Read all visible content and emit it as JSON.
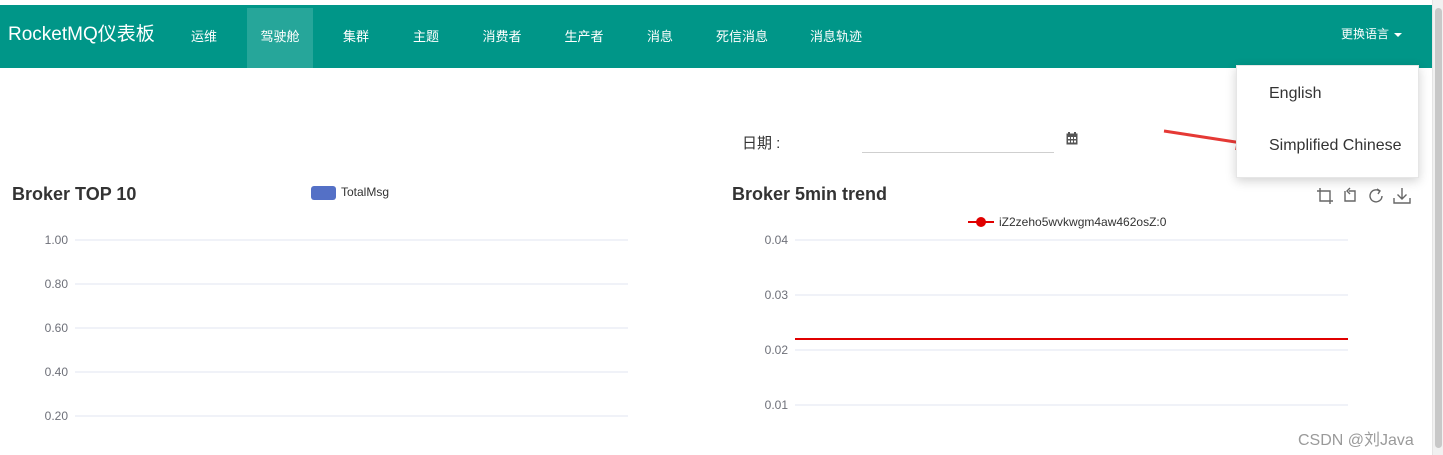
{
  "navbar": {
    "brand": "RocketMQ仪表板",
    "items": [
      {
        "label": "运维",
        "active": false
      },
      {
        "label": "驾驶舱",
        "active": true
      },
      {
        "label": "集群",
        "active": false
      },
      {
        "label": "主题",
        "active": false
      },
      {
        "label": "消费者",
        "active": false
      },
      {
        "label": "生产者",
        "active": false
      },
      {
        "label": "消息",
        "active": false
      },
      {
        "label": "死信消息",
        "active": false
      },
      {
        "label": "消息轨迹",
        "active": false
      }
    ],
    "language_label": "更换语言"
  },
  "language_dropdown": {
    "options": [
      "English",
      "Simplified Chinese"
    ]
  },
  "filter": {
    "date_label": "日期 :",
    "date_value": ""
  },
  "colors": {
    "navbar": "#009688",
    "active_tab": "#26a69a",
    "bar_series": "#5470c6",
    "trend_series": "#e00000",
    "annotation_arrow": "#e53935"
  },
  "icons": [
    "calendar-icon",
    "zoom-icon",
    "zoom-reset-icon",
    "restore-icon",
    "save-image-icon"
  ],
  "chart_data": [
    {
      "type": "bar",
      "title": "Broker TOP 10",
      "series": [
        {
          "name": "TotalMsg",
          "values": []
        }
      ],
      "yticks": [
        "1.00",
        "0.80",
        "0.60",
        "0.40",
        "0.20"
      ],
      "ylim": [
        0,
        1
      ],
      "grid": true,
      "legend": "top-center"
    },
    {
      "type": "line",
      "title": "Broker 5min trend",
      "series": [
        {
          "name": "iZ2zeho5wvkwgm4aw462osZ:0",
          "values": [
            0.022,
            0.022,
            0.022,
            0.022,
            0.022,
            0.022,
            0.022
          ]
        }
      ],
      "yticks": [
        "0.04",
        "0.03",
        "0.02",
        "0.01"
      ],
      "ylim": [
        0,
        0.04
      ],
      "grid": true,
      "legend": "top-center"
    }
  ],
  "watermark": "CSDN @刘Java"
}
